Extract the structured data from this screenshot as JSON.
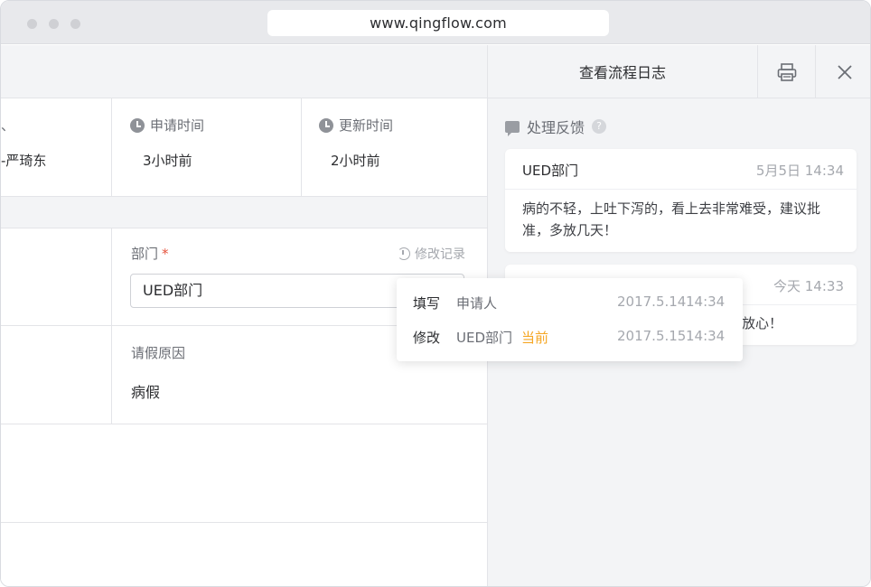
{
  "browser": {
    "url": "www.qingflow.com"
  },
  "meta": {
    "partial_label": "、",
    "partial_value": "-严琦东",
    "apply_time": {
      "label": "申请时间",
      "value": "3小时前"
    },
    "update_time": {
      "label": "更新时间",
      "value": "2小时前"
    }
  },
  "form": {
    "department": {
      "label": "部门",
      "required_mark": "*",
      "history_label": "修改记录",
      "value": "UED部门"
    },
    "reason": {
      "label": "请假原因",
      "value": "病假"
    }
  },
  "panel": {
    "title": "查看流程日志",
    "feedback_title": "处理反馈",
    "help_glyph": "?",
    "comments": [
      {
        "author": "UED部门",
        "time": "5月5日 14:34",
        "text": "病的不轻，上吐下泻的，看上去非常难受，建议批准，多放几天！"
      },
      {
        "author": "",
        "time": "今天 14:33",
        "text": "放心！"
      }
    ]
  },
  "history_popover": {
    "rows": [
      {
        "action": "填写",
        "who": "申请人",
        "tag": "",
        "date": "2017.5.14",
        "time": "14:34"
      },
      {
        "action": "修改",
        "who": "UED部门",
        "tag": "当前",
        "date": "2017.5.15",
        "time": "14:34"
      }
    ]
  },
  "colors": {
    "accent_current": "#f5a623",
    "required": "#e5533d",
    "panel_bg": "#f3f4f6"
  },
  "icons": {
    "clock": "clock-icon",
    "history": "history-icon",
    "print": "printer-icon",
    "close": "close-icon",
    "feedback": "chat-bubble-icon",
    "help": "help-icon"
  }
}
